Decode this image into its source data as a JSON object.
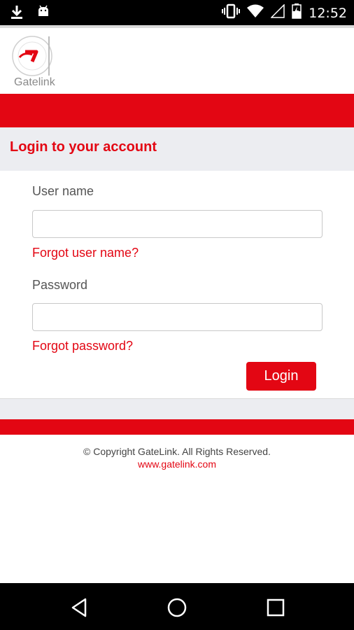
{
  "status_bar": {
    "time": "12:52",
    "icons": [
      "download-icon",
      "android-icon",
      "vibrate-icon",
      "wifi-icon",
      "signal-icon",
      "battery-charging-icon"
    ]
  },
  "app": {
    "logo_text": "Gatelink",
    "brand_color": "#e30613"
  },
  "login": {
    "title": "Login to your account",
    "username_label": "User name",
    "username_value": "",
    "forgot_username": "Forgot user name?",
    "password_label": "Password",
    "password_value": "",
    "forgot_password": "Forgot password?",
    "login_button": "Login"
  },
  "footer": {
    "copyright": "© Copyright GateLink. All Rights Reserved.",
    "website": "www.gatelink.com"
  },
  "nav_bar": {
    "buttons": [
      "back-icon",
      "home-icon",
      "recents-icon"
    ]
  }
}
